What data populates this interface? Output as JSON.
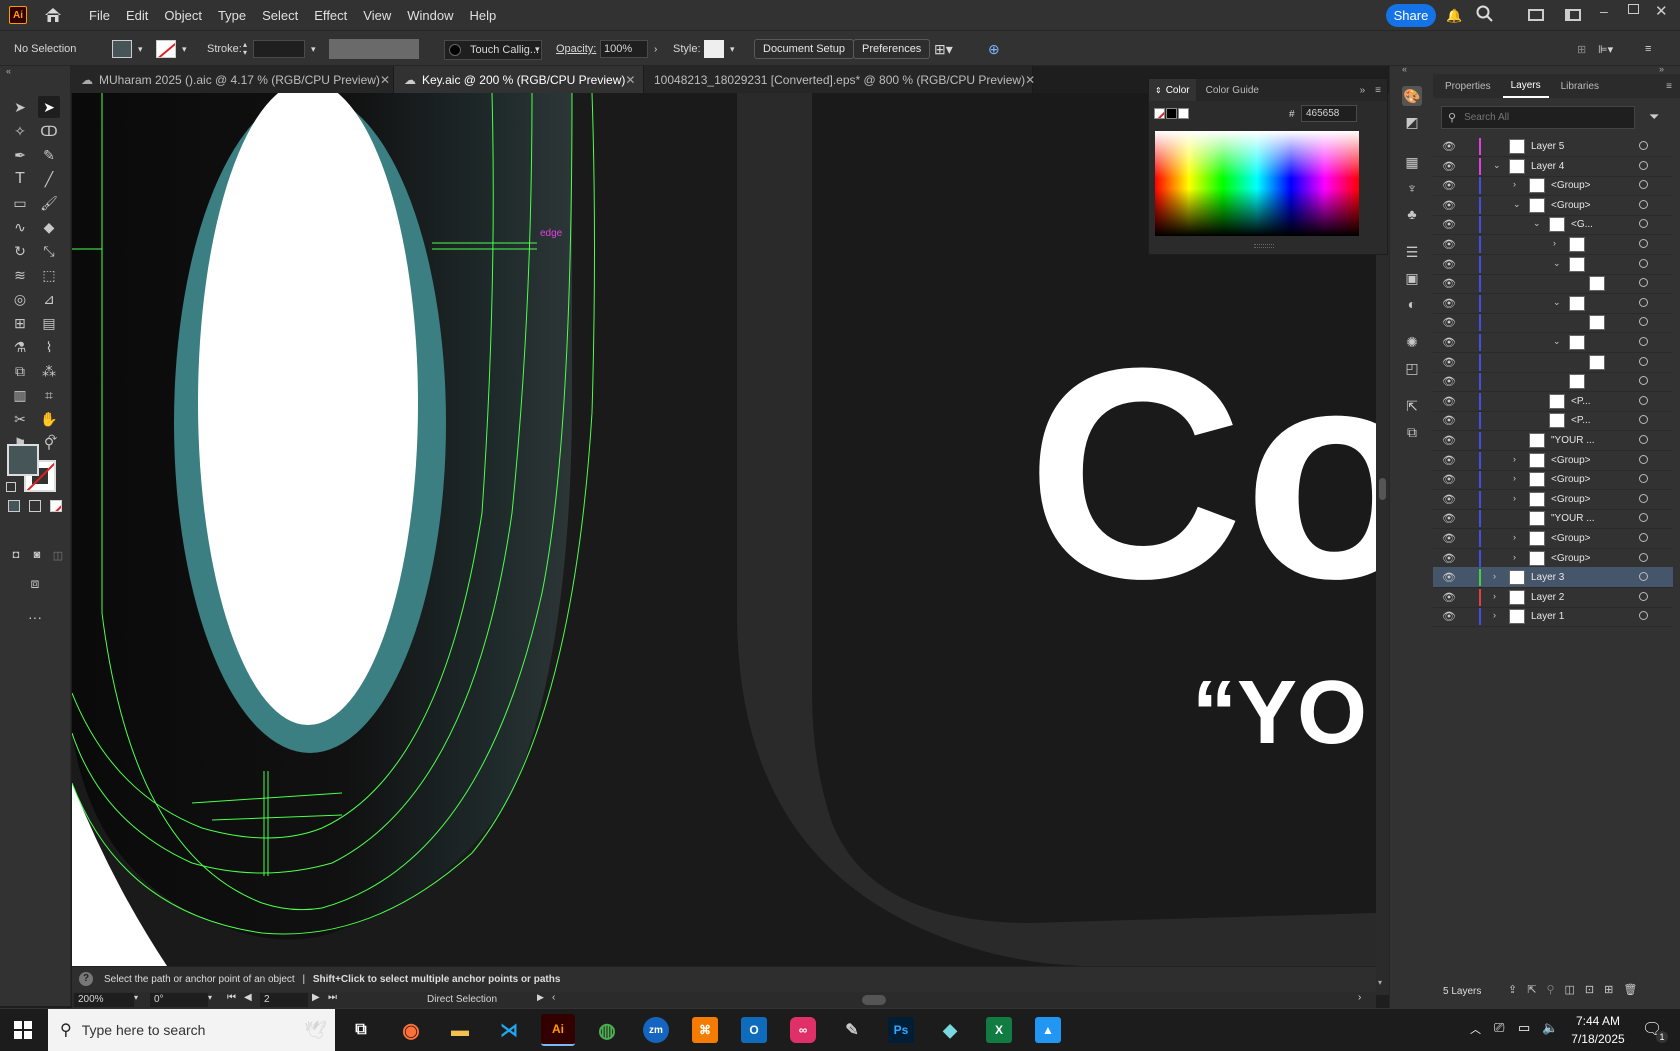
{
  "app": {
    "logo": "Ai",
    "share_label": "Share"
  },
  "menu": [
    "File",
    "Edit",
    "Object",
    "Type",
    "Select",
    "Effect",
    "View",
    "Window",
    "Help"
  ],
  "control": {
    "selection": "No Selection",
    "stroke_label": "Stroke:",
    "brush": "Touch Callig...",
    "opacity_label": "Opacity:",
    "opacity_value": "100%",
    "style_label": "Style:",
    "document_setup": "Document Setup",
    "preferences": "Preferences"
  },
  "tabs": [
    {
      "label": "MUharam 2025 ().aic @ 4.17 % (RGB/CPU Preview)",
      "active": false
    },
    {
      "label": "Key.aic @ 200 % (RGB/CPU Preview)",
      "active": true
    },
    {
      "label": "10048213_18029231 [Converted].eps* @ 800 % (RGB/CPU Preview)",
      "active": false
    }
  ],
  "canvas": {
    "edge_label": "edge",
    "big_letters": "Co",
    "quote_text": "“YO",
    "colors": {
      "teal": "#3b7f82",
      "bg": "#1a1a1a",
      "guide": "#4cff4c",
      "white": "#ffffff"
    }
  },
  "color_panel": {
    "tab_color": "Color",
    "tab_guide": "Color Guide",
    "hash": "#",
    "hex_value": "465658"
  },
  "layers_panel": {
    "tab_properties": "Properties",
    "tab_layers": "Layers",
    "tab_libraries": "Libraries",
    "search_placeholder": "Search All",
    "footer_count": "5 Layers",
    "rows": [
      {
        "name": "Layer 5",
        "arrow": "",
        "indent": 0,
        "color": "#e040e0",
        "selected": false
      },
      {
        "name": "Layer 4",
        "arrow": "v",
        "indent": 0,
        "color": "#e040e0",
        "selected": false
      },
      {
        "name": "<Group>",
        "arrow": ">",
        "indent": 1,
        "color": "#4050e0",
        "selected": false
      },
      {
        "name": "<Group>",
        "arrow": "v",
        "indent": 1,
        "color": "#4050e0",
        "selected": false
      },
      {
        "name": "<G...",
        "arrow": "v",
        "indent": 2,
        "color": "#4050e0",
        "selected": false
      },
      {
        "name": "",
        "arrow": ">",
        "indent": 3,
        "color": "#4050e0",
        "selected": false
      },
      {
        "name": "",
        "arrow": "v",
        "indent": 3,
        "color": "#4050e0",
        "selected": false
      },
      {
        "name": "",
        "arrow": "",
        "indent": 4,
        "color": "#4050e0",
        "selected": false
      },
      {
        "name": "",
        "arrow": "v",
        "indent": 3,
        "color": "#4050e0",
        "selected": false
      },
      {
        "name": "",
        "arrow": "",
        "indent": 4,
        "color": "#4050e0",
        "selected": false
      },
      {
        "name": "",
        "arrow": "v",
        "indent": 3,
        "color": "#4050e0",
        "selected": false
      },
      {
        "name": "",
        "arrow": "",
        "indent": 4,
        "color": "#4050e0",
        "selected": false
      },
      {
        "name": "",
        "arrow": "",
        "indent": 3,
        "color": "#4050e0",
        "selected": false
      },
      {
        "name": "<P...",
        "arrow": "",
        "indent": 2,
        "color": "#4050e0",
        "selected": false
      },
      {
        "name": "<P...",
        "arrow": "",
        "indent": 2,
        "color": "#4050e0",
        "selected": false
      },
      {
        "name": "\"YOUR ...",
        "arrow": "",
        "indent": 1,
        "color": "#4050e0",
        "selected": false
      },
      {
        "name": "<Group>",
        "arrow": ">",
        "indent": 1,
        "color": "#4050e0",
        "selected": false
      },
      {
        "name": "<Group>",
        "arrow": ">",
        "indent": 1,
        "color": "#4050e0",
        "selected": false
      },
      {
        "name": "<Group>",
        "arrow": ">",
        "indent": 1,
        "color": "#4050e0",
        "selected": false
      },
      {
        "name": "\"YOUR ...",
        "arrow": "",
        "indent": 1,
        "color": "#4050e0",
        "selected": false
      },
      {
        "name": "<Group>",
        "arrow": ">",
        "indent": 1,
        "color": "#4050e0",
        "selected": false
      },
      {
        "name": "<Group>",
        "arrow": ">",
        "indent": 1,
        "color": "#4050e0",
        "selected": false
      },
      {
        "name": "Layer 3",
        "arrow": ">",
        "indent": 0,
        "color": "#40d040",
        "selected": true
      },
      {
        "name": "Layer 2",
        "arrow": ">",
        "indent": 0,
        "color": "#e04040",
        "selected": false
      },
      {
        "name": "Layer 1",
        "arrow": ">",
        "indent": 0,
        "color": "#4050e0",
        "selected": false
      }
    ]
  },
  "status": {
    "hint_main": "Select the path or anchor point of an object",
    "hint_sep": "|",
    "hint_extra": "Shift+Click to select multiple anchor points or paths",
    "zoom": "200%",
    "rotate": "0°",
    "artboard": "2",
    "tool_name": "Direct Selection"
  },
  "taskbar": {
    "search_placeholder": "Type here to search",
    "time": "7:44 AM",
    "date": "7/18/2025",
    "notification_count": "1"
  }
}
